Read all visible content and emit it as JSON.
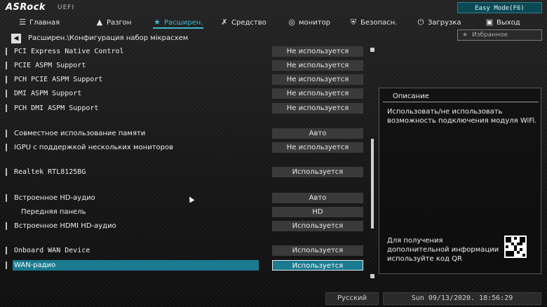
{
  "brand": {
    "logo": "ASRock",
    "subtitle": "UEFI"
  },
  "easy_mode_label": "Easy Mode(F6)",
  "nav": [
    {
      "label": "Главная",
      "icon": "list-icon"
    },
    {
      "label": "Разгон",
      "icon": "flame-icon"
    },
    {
      "label": "Расширен.",
      "icon": "star-icon",
      "active": true
    },
    {
      "label": "Средство",
      "icon": "tools-icon"
    },
    {
      "label": "монитор",
      "icon": "monitor-icon"
    },
    {
      "label": "Безопасн.",
      "icon": "shield-icon"
    },
    {
      "label": "Загрузка",
      "icon": "power-icon"
    },
    {
      "label": "Выход",
      "icon": "exit-icon"
    }
  ],
  "breadcrumb": "Расширен.\\Конфигурация набор мікрасхем",
  "favorites_label": "Избранное",
  "settings": [
    {
      "label": "PCI Express Native Control",
      "value": "Не используется"
    },
    {
      "label": "PCIE ASPM Support",
      "value": "Не используется"
    },
    {
      "label": "PCH PCIE ASPM Support",
      "value": "Не используется"
    },
    {
      "label": "DMI ASPM Support",
      "value": "Не используется"
    },
    {
      "label": "PCH DMI ASPM Support",
      "value": "Не используется"
    },
    {
      "label": "Совместное использование памяти",
      "value": "Авто"
    },
    {
      "label": "IGPU с поддержкой нескольких мониторов",
      "value": "Не используется"
    },
    {
      "label": "Realtek RTL8125BG",
      "value": "Используется"
    },
    {
      "label": "Встроенное HD-аудио",
      "value": "Авто"
    },
    {
      "label": "Передняя панель",
      "value": "HD"
    },
    {
      "label": "Встроенное HDMI HD-аудио",
      "value": "Используется"
    },
    {
      "label": "Onboard WAN Device",
      "value": "Используется"
    },
    {
      "label": "WAN-радио",
      "value": "Используется",
      "selected": true
    }
  ],
  "description": {
    "title": "Описание",
    "text": "Использовать/не использовать возможность подключения модуля WiFi.",
    "qr_text": "Для получения дополнительной информации используйте код QR"
  },
  "footer": {
    "language": "Русский",
    "datetime": "Sun 09/13/2020. 18:56:29"
  },
  "colors": {
    "accent": "#3fb9d0",
    "selected_row": "#1a7a90",
    "easy_mode_bg": "#0b4a55"
  }
}
